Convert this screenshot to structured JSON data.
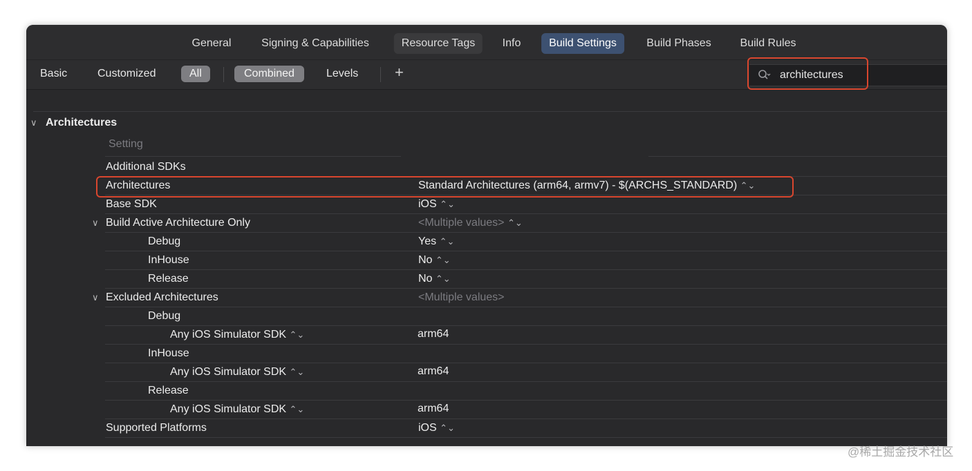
{
  "tabs": [
    "General",
    "Signing & Capabilities",
    "Resource Tags",
    "Info",
    "Build Settings",
    "Build Phases",
    "Build Rules"
  ],
  "filter": {
    "basic": "Basic",
    "customized": "Customized",
    "all": "All",
    "combined": "Combined",
    "levels": "Levels",
    "add": "+"
  },
  "search": {
    "value": "architectures"
  },
  "section": {
    "title": "Architectures",
    "setting_header": "Setting"
  },
  "rows": {
    "additional_sdks": {
      "label": "Additional SDKs"
    },
    "architectures": {
      "label": "Architectures",
      "value": "Standard Architectures (arm64, armv7)  -  $(ARCHS_STANDARD)"
    },
    "base_sdk": {
      "label": "Base SDK",
      "value": "iOS"
    },
    "build_active": {
      "label": "Build Active Architecture Only",
      "value": "<Multiple values>"
    },
    "bao_debug": {
      "label": "Debug",
      "value": "Yes"
    },
    "bao_inhouse": {
      "label": "InHouse",
      "value": "No"
    },
    "bao_release": {
      "label": "Release",
      "value": "No"
    },
    "excluded": {
      "label": "Excluded Architectures",
      "value": "<Multiple values>"
    },
    "ex_debug": {
      "label": "Debug"
    },
    "ex_debug_sdk": {
      "label": "Any iOS Simulator SDK",
      "value": "arm64"
    },
    "ex_inhouse": {
      "label": "InHouse"
    },
    "ex_inhouse_sdk": {
      "label": "Any iOS Simulator SDK",
      "value": "arm64"
    },
    "ex_release": {
      "label": "Release"
    },
    "ex_release_sdk": {
      "label": "Any iOS Simulator SDK",
      "value": "arm64"
    },
    "supported_platforms": {
      "label": "Supported Platforms",
      "value": "iOS"
    }
  },
  "stepper_glyph": "⌃⌄",
  "watermark": "@稀土掘金技术社区",
  "colors": {
    "highlight": "#d9462e",
    "active_tab": "#3d5171",
    "background": "#29292b"
  }
}
